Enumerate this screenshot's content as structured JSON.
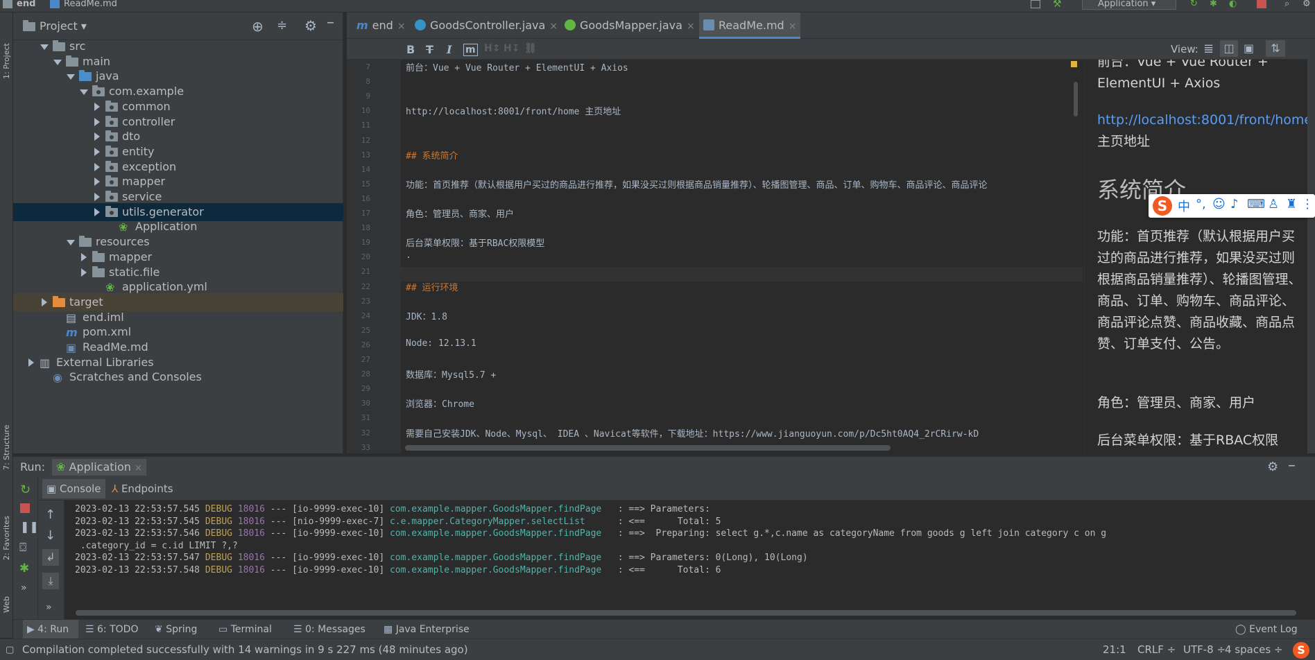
{
  "topbar": {
    "project": "end",
    "file": "ReadMe.md",
    "run_config": "Application"
  },
  "left_tabs": [
    "1: Project",
    "7: Structure",
    "2: Favorites",
    "Web"
  ],
  "project_panel": {
    "title": "Project",
    "tree": [
      {
        "label": "src",
        "depth": 1,
        "icon": "folder-gray",
        "arrow": "down"
      },
      {
        "label": "main",
        "depth": 2,
        "icon": "folder-gray",
        "arrow": "down"
      },
      {
        "label": "java",
        "depth": 3,
        "icon": "folder-blue",
        "arrow": "down"
      },
      {
        "label": "com.example",
        "depth": 4,
        "icon": "package",
        "arrow": "down"
      },
      {
        "label": "common",
        "depth": 5,
        "icon": "package",
        "arrow": "right"
      },
      {
        "label": "controller",
        "depth": 5,
        "icon": "package",
        "arrow": "right"
      },
      {
        "label": "dto",
        "depth": 5,
        "icon": "package",
        "arrow": "right"
      },
      {
        "label": "entity",
        "depth": 5,
        "icon": "package",
        "arrow": "right"
      },
      {
        "label": "exception",
        "depth": 5,
        "icon": "package",
        "arrow": "right"
      },
      {
        "label": "mapper",
        "depth": 5,
        "icon": "package",
        "arrow": "right"
      },
      {
        "label": "service",
        "depth": 5,
        "icon": "package",
        "arrow": "right"
      },
      {
        "label": "utils.generator",
        "depth": 5,
        "icon": "package",
        "arrow": "right",
        "selected": true
      },
      {
        "label": "Application",
        "depth": 6,
        "icon": "spring-class",
        "arrow": "none"
      },
      {
        "label": "resources",
        "depth": 3,
        "icon": "folder-resources",
        "arrow": "down"
      },
      {
        "label": "mapper",
        "depth": 4,
        "icon": "folder-gray",
        "arrow": "right"
      },
      {
        "label": "static.file",
        "depth": 4,
        "icon": "folder-gray",
        "arrow": "right"
      },
      {
        "label": "application.yml",
        "depth": 5,
        "icon": "yml-file",
        "arrow": "none"
      },
      {
        "label": "target",
        "depth": 1,
        "icon": "folder-orange",
        "arrow": "right",
        "highlight": true
      },
      {
        "label": "end.iml",
        "depth": 2,
        "icon": "iml-file",
        "arrow": "none"
      },
      {
        "label": "pom.xml",
        "depth": 2,
        "icon": "maven-file",
        "arrow": "none"
      },
      {
        "label": "ReadMe.md",
        "depth": 2,
        "icon": "md-file",
        "arrow": "none"
      },
      {
        "label": "External Libraries",
        "depth": 0,
        "icon": "library",
        "arrow": "right"
      },
      {
        "label": "Scratches and Consoles",
        "depth": 1,
        "icon": "scratches",
        "arrow": "none"
      }
    ]
  },
  "editor": {
    "tabs": [
      {
        "label": "end",
        "icon": "m"
      },
      {
        "label": "GoodsController.java",
        "icon": "c"
      },
      {
        "label": "GoodsMapper.java",
        "icon": "i"
      },
      {
        "label": "ReadMe.md",
        "icon": "md",
        "active": true
      }
    ],
    "view_label": "View:",
    "line_numbers": [
      "7",
      "8",
      "9",
      "10",
      "11",
      "12",
      "13",
      "14",
      "15",
      "16",
      "17",
      "18",
      "19",
      "20",
      "21",
      "22",
      "23",
      "24",
      "25",
      "26",
      "27",
      "28",
      "29",
      "30",
      "31",
      "32",
      "33"
    ],
    "lines": [
      "前台：Vue + Vue Router + ElementUI + Axios",
      "",
      "",
      "http://localhost:8001/front/home  主页地址",
      "",
      "",
      "## 系统简介",
      "",
      "功能：首页推荐（默认根据用户买过的商品进行推荐，如果没买过则根据商品销量推荐）、轮播图管理、商品、订单、购物车、商品评论、商品评论",
      "",
      "角色：管理员、商家、用户",
      "",
      "后台菜单权限：基于RBAC权限模型",
      ".",
      "",
      "## 运行环境",
      "",
      "JDK：1.8",
      "",
      "Node:  12.13.1",
      "",
      "数据库：Mysql5.7 +",
      "",
      "浏览器：Chrome",
      "",
      "需要自己安装JDK、Node、Mysql、  IDEA 、Navicat等软件，下载地址：https://www.jianguoyun.com/p/Dc5ht0AQ4_2rCRirw-kD",
      ""
    ]
  },
  "preview": {
    "frontend_line": "前台：Vue + Vue Router + ElementUI + Axios",
    "link": "http://localhost:8001/front/home",
    "link_suffix": "主页地址",
    "heading": "系统简介",
    "features": "功能：首页推荐（默认根据用户买过的商品进行推荐，如果没买过则根据商品销量推荐）、轮播图管理、商品、订单、购物车、商品评论、商品评论点赞、商品收藏、商品点赞、订单支付、公告。",
    "roles": "角色：管理员、商家、用户",
    "menu": "后台菜单权限：基于RBAC权限"
  },
  "ime": {
    "lang": "中"
  },
  "run": {
    "label": "Run:",
    "config": "Application",
    "tabs": [
      "Console",
      "Endpoints"
    ],
    "log": [
      {
        "ts": "2023-02-13 22:53:57.545",
        "level": "DEBUG",
        "pid": "18016",
        "sep": "---",
        "thread": "[io-9999-exec-10]",
        "logger": "com.example.mapper.GoodsMapper.findPage  ",
        "msg": " : ==> Parameters:"
      },
      {
        "ts": "2023-02-13 22:53:57.545",
        "level": "DEBUG",
        "pid": "18016",
        "sep": "---",
        "thread": "[nio-9999-exec-7]",
        "logger": "c.e.mapper.CategoryMapper.selectList     ",
        "msg": " : <==      Total: 5"
      },
      {
        "ts": "2023-02-13 22:53:57.546",
        "level": "DEBUG",
        "pid": "18016",
        "sep": "---",
        "thread": "[io-9999-exec-10]",
        "logger": "com.example.mapper.GoodsMapper.findPage  ",
        "msg": " : ==>  Preparing: select g.*,c.name as categoryName from goods g left join category c on g"
      },
      {
        "ts": "",
        "level": "",
        "pid": "",
        "sep": "",
        "thread": "",
        "logger": "",
        "msg": " .category_id = c.id LIMIT ?,?"
      },
      {
        "ts": "2023-02-13 22:53:57.547",
        "level": "DEBUG",
        "pid": "18016",
        "sep": "---",
        "thread": "[io-9999-exec-10]",
        "logger": "com.example.mapper.GoodsMapper.findPage  ",
        "msg": " : ==> Parameters: 0(Long), 10(Long)"
      },
      {
        "ts": "2023-02-13 22:53:57.548",
        "level": "DEBUG",
        "pid": "18016",
        "sep": "---",
        "thread": "[io-9999-exec-10]",
        "logger": "com.example.mapper.GoodsMapper.findPage  ",
        "msg": " : <==      Total: 6"
      }
    ]
  },
  "bottom_tabs": [
    {
      "label": "4: Run"
    },
    {
      "label": "6: TODO"
    },
    {
      "label": "Spring"
    },
    {
      "label": "Terminal"
    },
    {
      "label": "0: Messages"
    },
    {
      "label": "Java Enterprise"
    }
  ],
  "event_log": "Event Log",
  "status": {
    "message": "Compilation completed successfully with 14 warnings in 9 s 227 ms (48 minutes ago)",
    "position": "21:1",
    "line_sep": "CRLF ÷",
    "encoding": "UTF-8 ÷",
    "indent": "4 spaces ÷"
  },
  "colors": {
    "accent": "#4a88c7",
    "debug": "#c3a04d",
    "logger": "#4db6ac",
    "heading": "#cc7832"
  }
}
